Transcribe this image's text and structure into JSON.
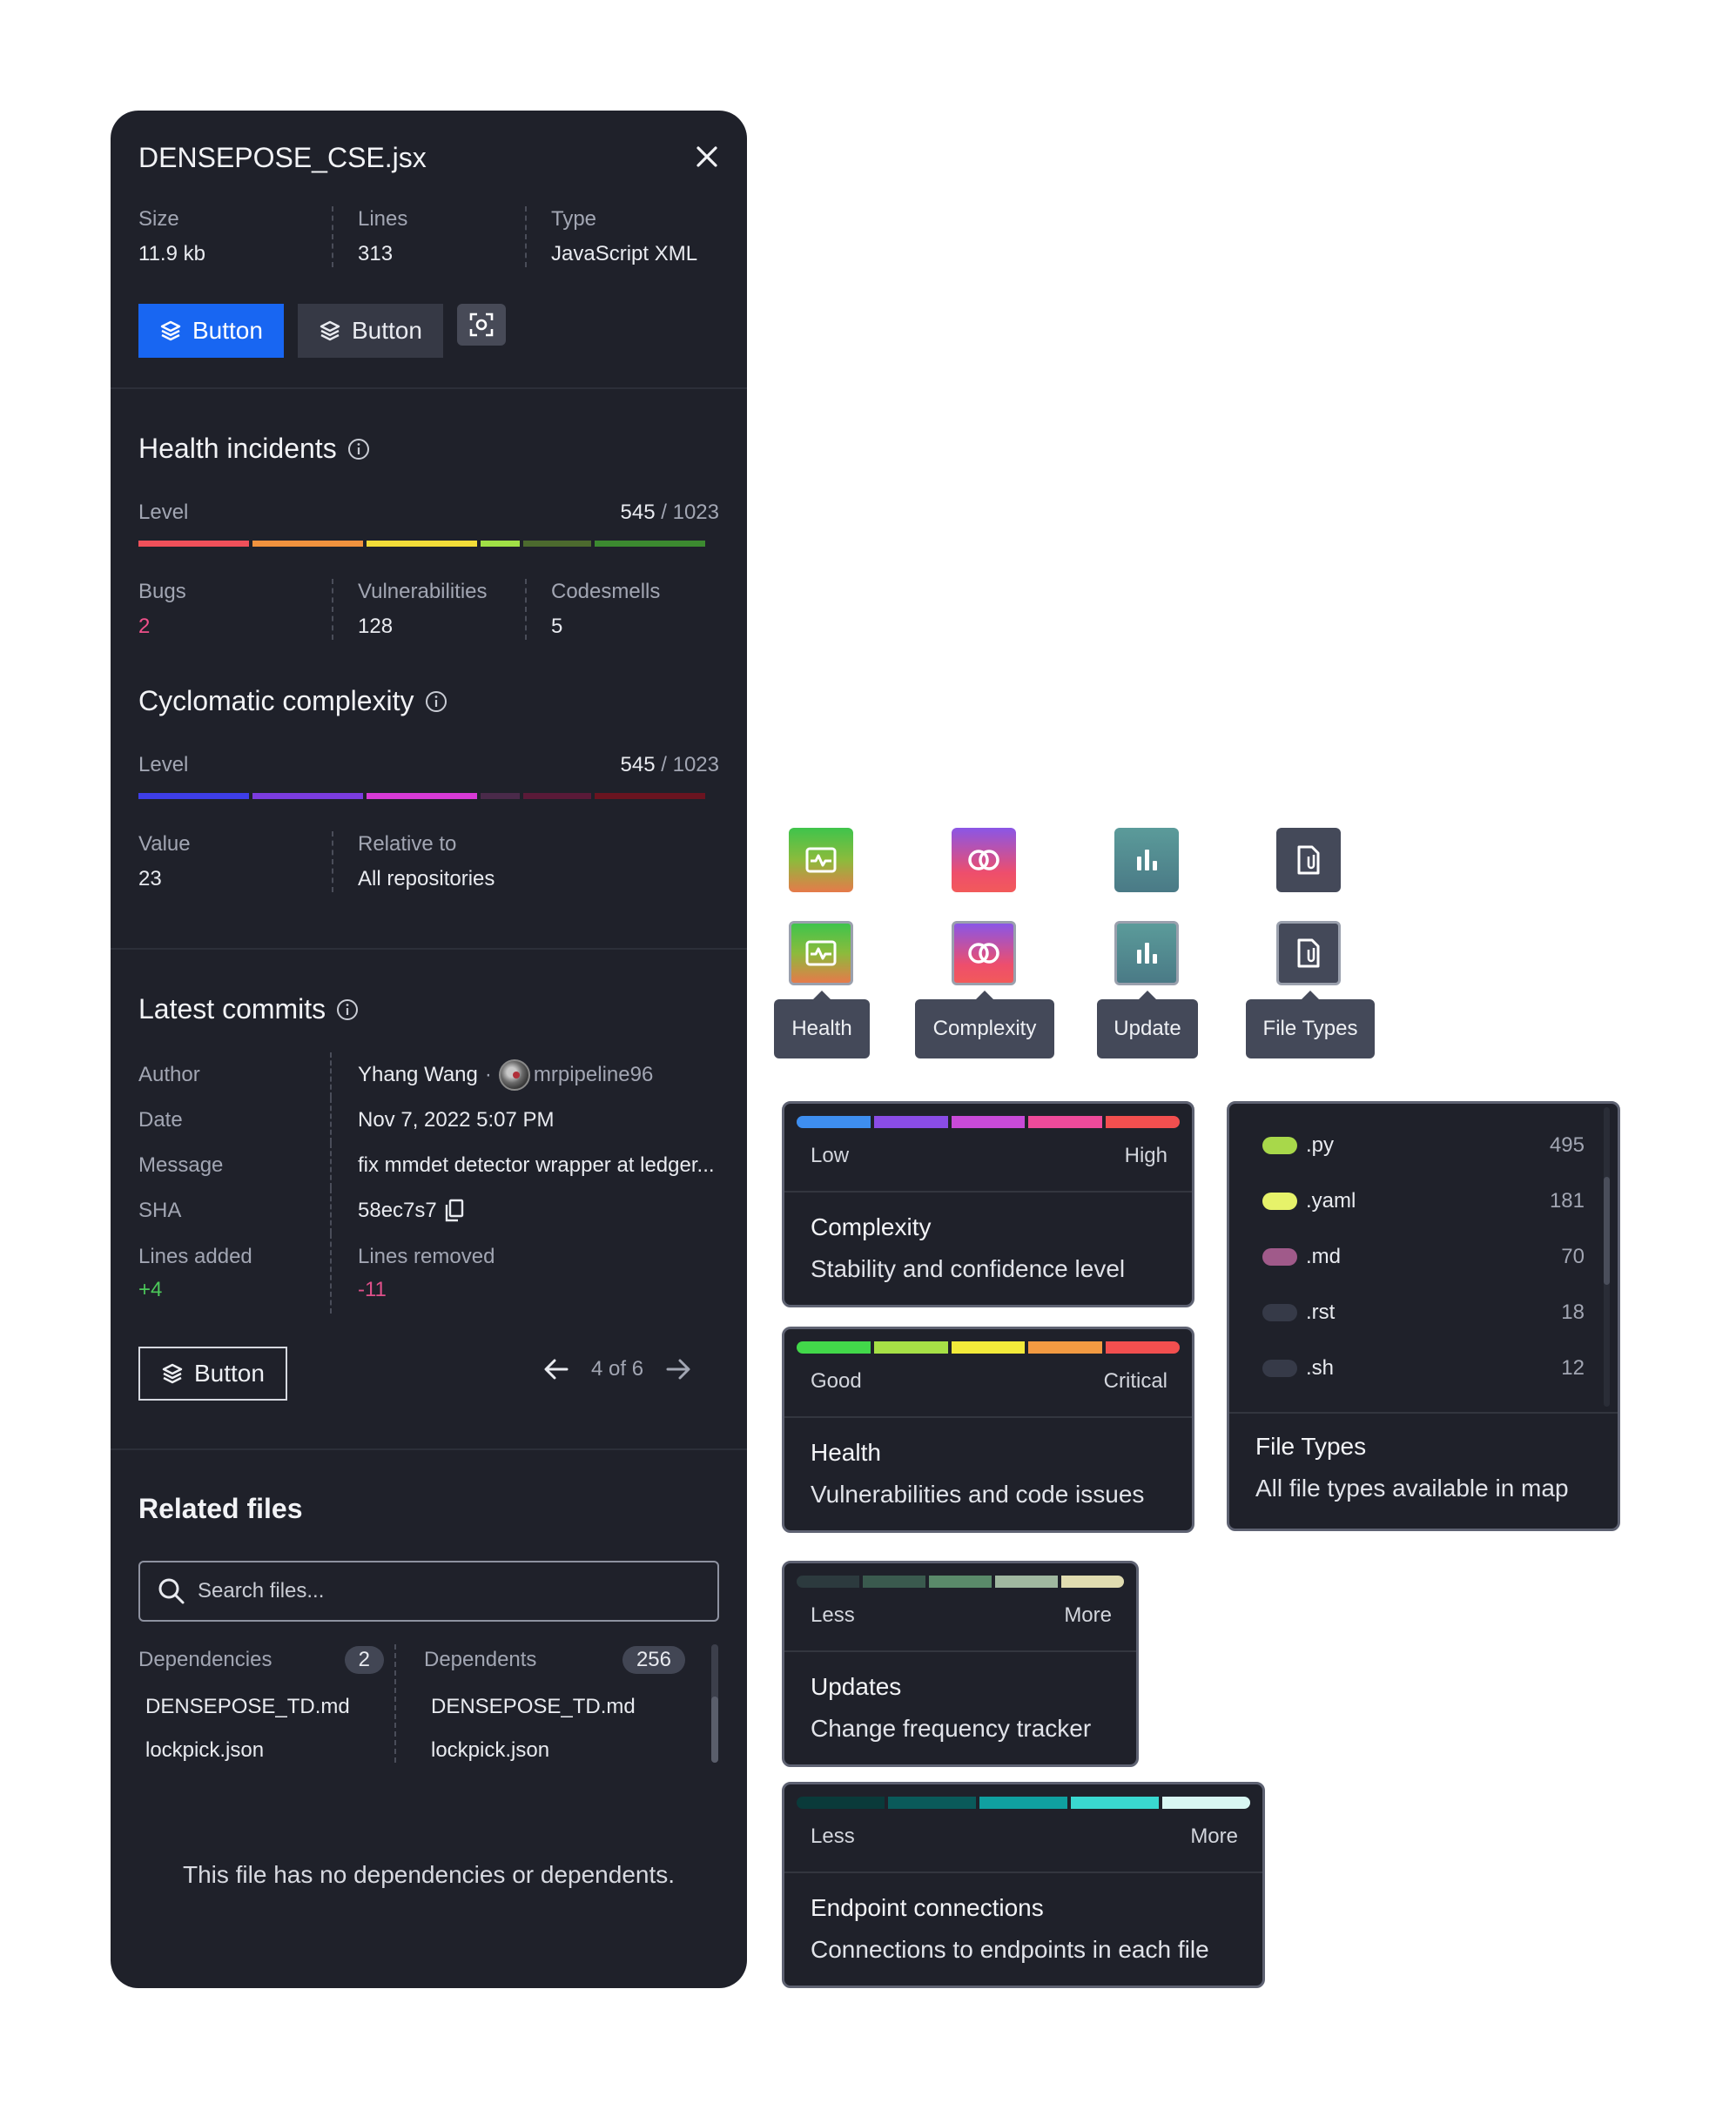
{
  "panel": {
    "file_name": "DENSEPOSE_CSE.jsx",
    "meta": [
      {
        "label": "Size",
        "value": "11.9 kb"
      },
      {
        "label": "Lines",
        "value": "313"
      },
      {
        "label": "Type",
        "value": "JavaScript XML"
      }
    ],
    "buttons": {
      "primary_label": "Button",
      "secondary_label": "Button",
      "outline_label": "Button"
    }
  },
  "health": {
    "title": "Health incidents",
    "level_label": "Level",
    "level_value": "545",
    "level_total": "/ 1023",
    "bar_colors": [
      "#f0505a",
      "#f0923e",
      "#f2dc38",
      "#a0e046",
      "#4c6a2e",
      "#3c8a30"
    ],
    "stats": [
      {
        "label": "Bugs",
        "value": "2",
        "color": "#f0508a"
      },
      {
        "label": "Vulnerabilities",
        "value": "128",
        "color": "#e9ebf0"
      },
      {
        "label": "Codesmells",
        "value": "5",
        "color": "#e9ebf0"
      }
    ]
  },
  "complexity": {
    "title": "Cyclomatic complexity",
    "level_label": "Level",
    "level_value": "545",
    "level_total": "/ 1023",
    "bar_colors": [
      "#3e3ee8",
      "#7c3ce0",
      "#d83ad6",
      "#4a2a4a",
      "#5a1a38",
      "#6a1420"
    ],
    "stats": [
      {
        "label": "Value",
        "value": "23"
      },
      {
        "label": "Relative to",
        "value": "All repositories"
      }
    ]
  },
  "commits": {
    "title": "Latest commits",
    "author_label": "Author",
    "author_name": "Yhang Wang",
    "author_sep": "·",
    "author_handle": "mrpipeline96",
    "date_label": "Date",
    "date_value": "Nov 7, 2022 5:07 PM",
    "message_label": "Message",
    "message_value": "fix mmdet detector wrapper at ledger...",
    "sha_label": "SHA",
    "sha_value": "58ec7s7",
    "added_label": "Lines added",
    "added_value": "+4",
    "removed_label": "Lines removed",
    "removed_value": "-11",
    "pager": "4 of 6"
  },
  "related": {
    "title": "Related files",
    "search_placeholder": "Search files...",
    "dependencies_label": "Dependencies",
    "dependencies_count": "2",
    "dependents_label": "Dependents",
    "dependents_count": "256",
    "dependencies": [
      "DENSEPOSE_TD.md",
      "lockpick.json"
    ],
    "dependents": [
      "DENSEPOSE_TD.md",
      "lockpick.json"
    ],
    "empty_message": "This file has no dependencies or dependents."
  },
  "tooltips": [
    "Health",
    "Complexity",
    "Update",
    "File Types"
  ],
  "legend_cards": {
    "complexity": {
      "low": "Low",
      "high": "High",
      "title": "Complexity",
      "subtitle": "Stability and confidence level",
      "colors": [
        "#3e8ef0",
        "#8a4ce6",
        "#c84ad8",
        "#ee4a9a",
        "#f24f4f"
      ]
    },
    "health": {
      "low": "Good",
      "high": "Critical",
      "title": "Health",
      "subtitle": "Vulnerabilities and code issues",
      "colors": [
        "#42d84a",
        "#a6e046",
        "#f2ea3a",
        "#f29a42",
        "#f24f4f"
      ]
    },
    "updates": {
      "low": "Less",
      "high": "More",
      "title": "Updates",
      "subtitle": "Change frequency tracker",
      "colors": [
        "#2c3a3e",
        "#3a5a4e",
        "#5a8a6a",
        "#a0b8a0",
        "#e0dcb0"
      ]
    },
    "endpoints": {
      "low": "Less",
      "high": "More",
      "title": "Endpoint connections",
      "subtitle": "Connections to endpoints in each file",
      "colors": [
        "#0a3a3a",
        "#0a5a5a",
        "#10a0a0",
        "#3ad8d0",
        "#d8f6f2"
      ]
    }
  },
  "file_types": {
    "title": "File Types",
    "subtitle": "All file types available in map",
    "items": [
      {
        "name": ".py",
        "count": "495",
        "color": "#a8d84a"
      },
      {
        "name": ".yaml",
        "count": "181",
        "color": "#e6f26a"
      },
      {
        "name": ".md",
        "count": "70",
        "color": "#a05a8a"
      },
      {
        "name": ".rst",
        "count": "18",
        "color": "#363a48"
      },
      {
        "name": ".sh",
        "count": "12",
        "color": "#363a48"
      }
    ]
  }
}
